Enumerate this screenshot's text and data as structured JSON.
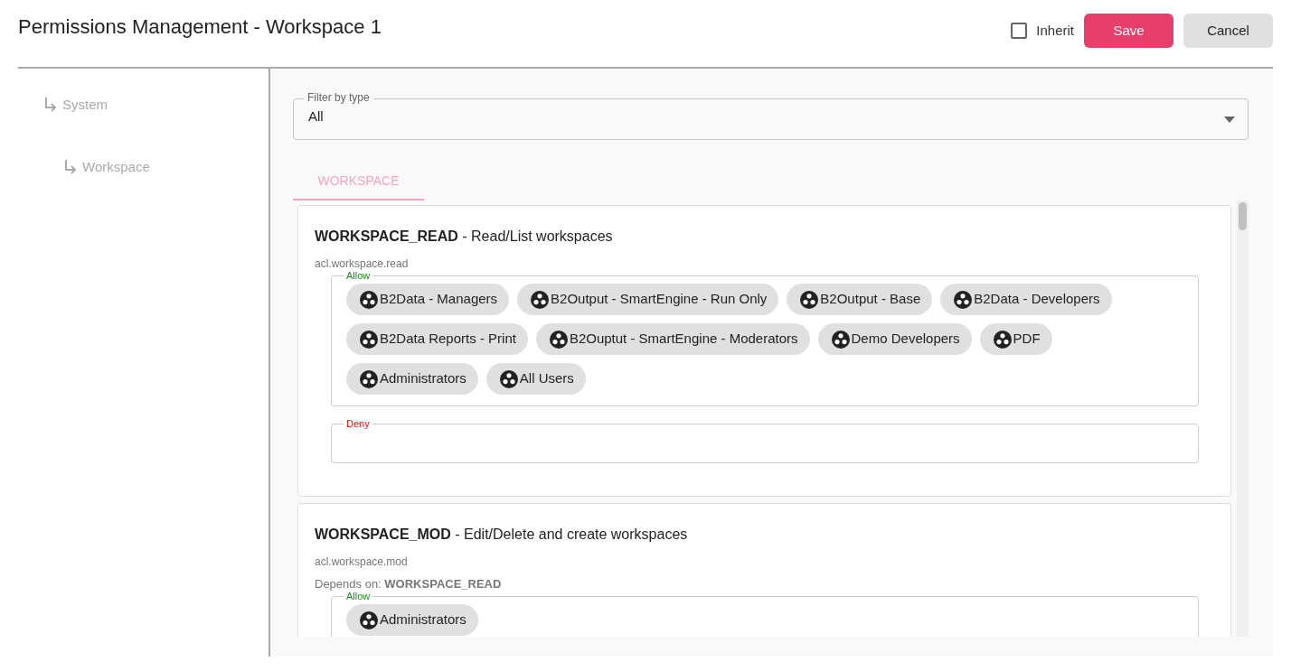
{
  "header": {
    "title": "Permissions Management - Workspace 1",
    "inherit": {
      "label": "Inherit",
      "checked": false
    },
    "buttons": [
      {
        "label": "Save",
        "kind": "primary"
      },
      {
        "label": "Cancel",
        "kind": "secondary"
      }
    ]
  },
  "tree": [
    {
      "label": "System",
      "children": [
        {
          "label": "Workspace"
        }
      ]
    }
  ],
  "filter": {
    "label": "Filter by type",
    "value": "All"
  },
  "tabs": [
    {
      "label": "WORKSPACE",
      "selected": true
    }
  ],
  "permissions": [
    {
      "title": "**WORKSPACE_READ** - Read/List workspaces",
      "key": "acl.workspace.read",
      "groups": [
        {
          "kind": "allow",
          "label": "Allow",
          "members": [
            "B2Data - Managers",
            "B2Output - SmartEngine - Run Only",
            "B2Output - Base",
            "B2Data - Developers",
            "B2Data Reports - Print",
            "B2Ouptut - SmartEngine - Moderators",
            "Demo Developers",
            "PDF",
            "Administrators",
            "All Users"
          ]
        },
        {
          "kind": "deny",
          "label": "Deny"
        }
      ]
    },
    {
      "title": "**WORKSPACE_MOD** - Edit/Delete and create workspaces",
      "key": "acl.workspace.mod",
      "depends_on": "Depends on: **WORKSPACE_READ**",
      "groups": [
        {
          "kind": "allow",
          "label": "Allow",
          "members": [
            "Administrators"
          ]
        }
      ]
    }
  ]
}
